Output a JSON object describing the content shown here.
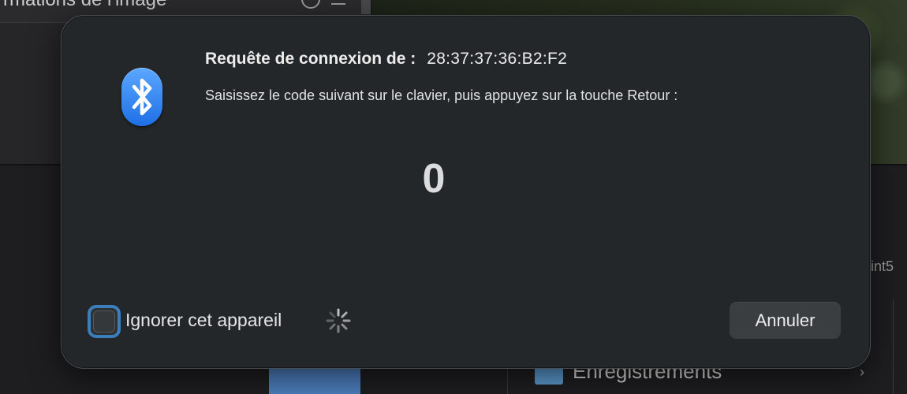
{
  "background": {
    "window_title": "rmations de l'image",
    "right_fragment": "int5",
    "folder_label": "Enregistrements",
    "folder_color": "#5c9bd1"
  },
  "dialog": {
    "icon": "bluetooth-icon",
    "title_label": "Requête de connexion de :",
    "device_address": "28:37:37:36:B2:F2",
    "instruction": "Saisissez le code suivant sur le clavier, puis appuyez sur la touche Retour :",
    "code": "0",
    "ignore_label": "Ignorer cet appareil",
    "ignore_checked": false,
    "cancel_label": "Annuler",
    "accent_color": "#3c7dbb"
  }
}
